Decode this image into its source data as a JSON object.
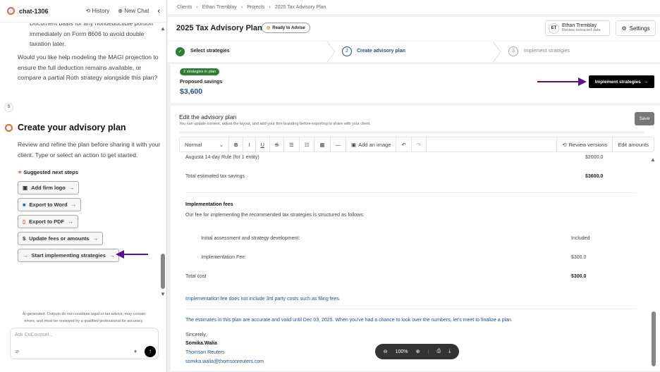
{
  "chat": {
    "title": "chat-1306",
    "history": "History",
    "new_chat": "New Chat",
    "messages": [
      "Document basis for any nondeductible portion",
      "immediately on Form 8606 to avoid double",
      "taxation later.",
      "Would you like help modeling the MAGI projection to",
      "ensure the full deduction remains available, or",
      "compare a partial Roth strategy alongside this plan?"
    ],
    "user_initial": "S",
    "heading": "Create your advisory plan",
    "intro": [
      "Review and refine the plan before sharing it with your",
      "client. Type or select an action to get started."
    ],
    "suggested_label": "Suggested next steps",
    "suggestions": [
      {
        "label": "Add firm logo"
      },
      {
        "label": "Export to Word"
      },
      {
        "label": "Export to PDF"
      },
      {
        "label": "Update fees or amounts"
      },
      {
        "label": "Start implementing strategies"
      }
    ],
    "disclaimer": [
      "AI-generated. Outputs do not constitute legal or tax advice, may contain",
      "errors, and must be reviewed by a qualified professional for accuracy."
    ],
    "input_placeholder": "Ask CoCounsel..."
  },
  "breadcrumb": [
    "Clients",
    "Ethan Tremblay",
    "Projects",
    "2025 Tax Advisory Plan"
  ],
  "header": {
    "title": "2025 Tax Advisory Plan",
    "status": "Ready to Advise",
    "client_initials": "ET",
    "client_name": "Ethan Tremblay",
    "client_sub": "Review extracted data",
    "settings": "Settings"
  },
  "steps": [
    {
      "num": "1",
      "label": "Select strategies",
      "state": "done"
    },
    {
      "num": "2",
      "label": "Create advisory plan",
      "state": "active"
    },
    {
      "num": "3",
      "label": "Implement strategies",
      "state": "pending"
    }
  ],
  "savings": {
    "badge": "2 strategies in plan",
    "label": "Proposed savings",
    "value": "$3,600",
    "cta": "Implement strategies"
  },
  "editor": {
    "title": "Edit the advisory plan",
    "subtitle": "You can update content, adjust the layout, and add your firm branding before exporting to share with your client.",
    "save": "Save",
    "toolbar": {
      "style": "Normal",
      "add_image": "Add an image",
      "review_versions": "Review versions",
      "edit_amounts": "Edit amounts"
    },
    "doc": {
      "row1_label": "Augusta 14-day Rule (for 1 entity)",
      "row1_value": "$2000.0",
      "total_label": "Total estimated tax savings",
      "total_value": "$3600.0",
      "fees_heading": "Implementation fees",
      "fees_intro": "Our fee for implementing the recommended tax strategies is structured as follows:",
      "fee1_label": "Initial assessment and strategy development:",
      "fee1_value": "Included",
      "fee2_label": "Implementation Fee:",
      "fee2_value": "$300.0",
      "total_cost_label": "Total cost",
      "total_cost_value": "$300.0",
      "note": "Implementation fee does not include 3rd party costs such as filing fees.",
      "validity": "The estimates in this plan are accurate and valid until Dec 03, 2025. When you've had a chance to look over the numbers, let's meet to finalize a plan.",
      "closing": "Sincerely,",
      "signer": "Somika.Walia",
      "company": "Thomson Reuters",
      "email": "somika.walia@thomsonreuters.com"
    }
  },
  "zoom": {
    "level": "100%"
  },
  "colors": {
    "accent": "#1f4f8f",
    "annotation": "#5e0f86",
    "success": "#2e7d32"
  }
}
